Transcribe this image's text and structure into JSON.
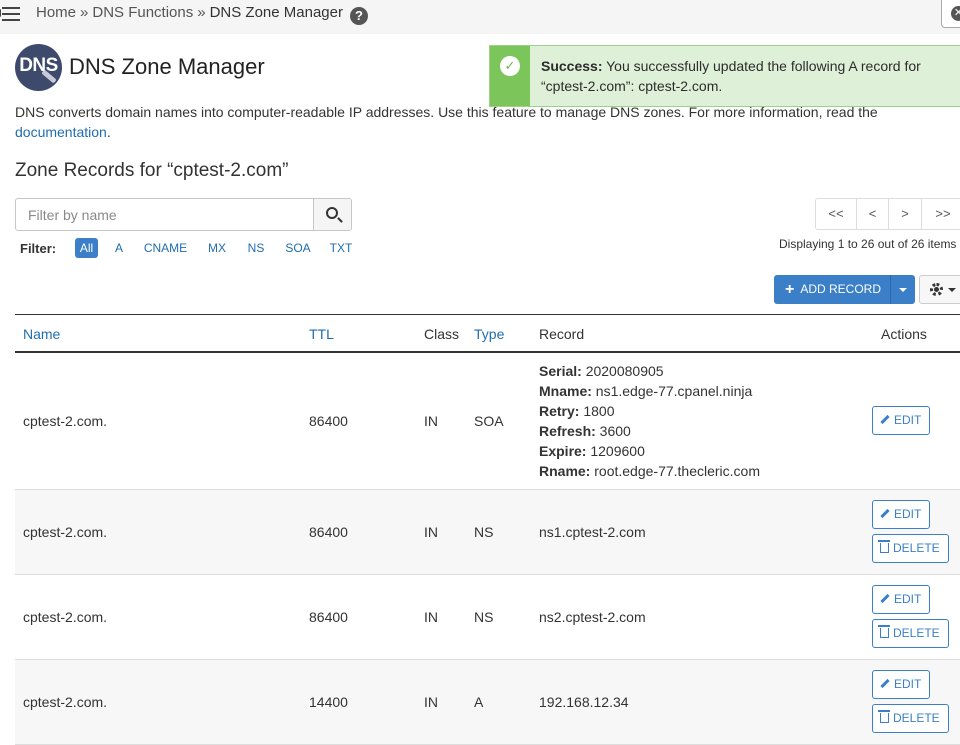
{
  "breadcrumb": {
    "items": [
      "Home",
      "DNS Functions",
      "DNS Zone Manager"
    ],
    "separator": "»"
  },
  "header": {
    "logo_text": "DNS",
    "title": "DNS Zone Manager"
  },
  "alert": {
    "strong": "Success:",
    "message": " You successfully updated the following A record for “cptest-2.com”: cptest-2.com."
  },
  "description": {
    "text": "DNS converts domain names into computer-readable IP addresses. Use this feature to manage DNS zones. For more information, read the ",
    "link": "documentation",
    "end": "."
  },
  "zone_heading": "Zone Records for “cptest-2.com”",
  "search": {
    "placeholder": "Filter by name"
  },
  "filter": {
    "label": "Filter:",
    "options": [
      "All",
      "A",
      "CNAME",
      "MX",
      "NS",
      "SOA",
      "TXT"
    ],
    "active": "All"
  },
  "pagination": {
    "first": "<<",
    "prev": "<",
    "next": ">",
    "last": ">>",
    "status": "Displaying 1 to 26 out of 26 items"
  },
  "add_record": {
    "label": "ADD RECORD"
  },
  "table": {
    "headers": {
      "name": "Name",
      "ttl": "TTL",
      "class": "Class",
      "type": "Type",
      "record": "Record",
      "actions": "Actions"
    },
    "edit_label": "EDIT",
    "delete_label": "DELETE",
    "rows": [
      {
        "name": "cptest-2.com.",
        "ttl": "86400",
        "class": "IN",
        "type": "SOA",
        "soa": [
          {
            "k": "Serial:",
            "v": " 2020080905"
          },
          {
            "k": "Mname:",
            "v": " ns1.edge-77.cpanel.ninja"
          },
          {
            "k": "Retry:",
            "v": " 1800"
          },
          {
            "k": "Refresh:",
            "v": " 3600"
          },
          {
            "k": "Expire:",
            "v": " 1209600"
          },
          {
            "k": "Rname:",
            "v": " root.edge-77.thecleric.com"
          }
        ]
      },
      {
        "name": "cptest-2.com.",
        "ttl": "86400",
        "class": "IN",
        "type": "NS",
        "record": "ns1.cptest-2.com"
      },
      {
        "name": "cptest-2.com.",
        "ttl": "86400",
        "class": "IN",
        "type": "NS",
        "record": "ns2.cptest-2.com"
      },
      {
        "name": "cptest-2.com.",
        "ttl": "14400",
        "class": "IN",
        "type": "A",
        "record": "192.168.12.34"
      }
    ]
  },
  "colors": {
    "accent": "#3a7fc8",
    "link": "#1f6db0",
    "success_bg": "#dff0d8",
    "success_bar": "#7bc55b"
  }
}
